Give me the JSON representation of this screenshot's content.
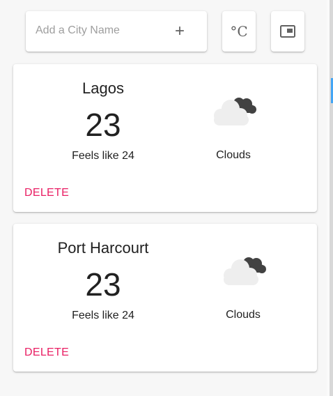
{
  "search": {
    "placeholder": "Add a City Name",
    "add_label": "+"
  },
  "toolbar": {
    "unit_label": "°C",
    "layout_icon": "picture-in-picture-icon"
  },
  "cards": [
    {
      "city": "Lagos",
      "temp": "23",
      "feels": "Feels like 24",
      "condition": "Clouds",
      "icon": "clouds-icon",
      "delete_label": "DELETE"
    },
    {
      "city": "Port Harcourt",
      "temp": "23",
      "feels": "Feels like 24",
      "condition": "Clouds",
      "icon": "clouds-icon",
      "delete_label": "DELETE"
    }
  ],
  "colors": {
    "delete": "#e91e63",
    "accent": "#42a5f5",
    "cloud_light": "#eeeeee",
    "cloud_dark": "#424242"
  }
}
